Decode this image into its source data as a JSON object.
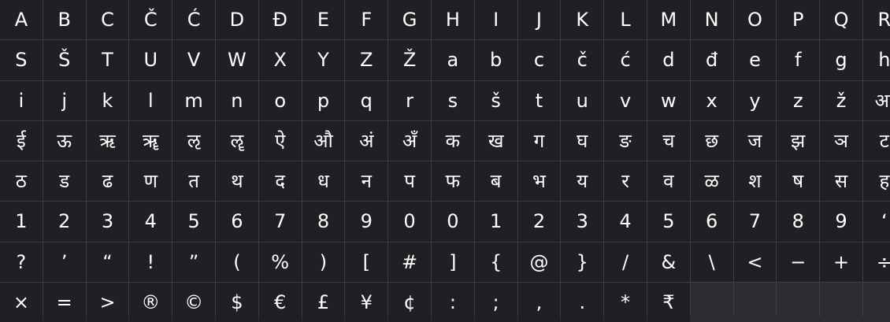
{
  "glyph_grid": {
    "glyphs": [
      "A",
      "B",
      "C",
      "Č",
      "Ć",
      "D",
      "Đ",
      "E",
      "F",
      "G",
      "H",
      "I",
      "J",
      "K",
      "L",
      "M",
      "N",
      "O",
      "P",
      "Q",
      "R",
      "S",
      "Š",
      "T",
      "U",
      "V",
      "W",
      "X",
      "Y",
      "Z",
      "Ž",
      "a",
      "b",
      "c",
      "č",
      "ć",
      "d",
      "đ",
      "e",
      "f",
      "g",
      "h",
      "i",
      "j",
      "k",
      "l",
      "m",
      "n",
      "o",
      "p",
      "q",
      "r",
      "s",
      "š",
      "t",
      "u",
      "v",
      "w",
      "x",
      "y",
      "z",
      "ž",
      "आ",
      "ई",
      "ऊ",
      "ऋ",
      "ॠ",
      "ऌ",
      "ॡ",
      "ऐ",
      "औ",
      "अं",
      "अँ",
      "क",
      "ख",
      "ग",
      "घ",
      "ङ",
      "च",
      "छ",
      "ज",
      "झ",
      "ञ",
      "ट",
      "ठ",
      "ड",
      "ढ",
      "ण",
      "त",
      "थ",
      "द",
      "ध",
      "न",
      "प",
      "फ",
      "ब",
      "भ",
      "य",
      "र",
      "व",
      "ळ",
      "श",
      "ष",
      "स",
      "ह",
      "1",
      "2",
      "3",
      "4",
      "5",
      "6",
      "7",
      "8",
      "9",
      "0",
      "0",
      "1",
      "2",
      "3",
      "4",
      "5",
      "6",
      "7",
      "8",
      "9",
      "‘",
      "?",
      "’",
      "“",
      "!",
      "”",
      "(",
      "%",
      ")",
      "[",
      "#",
      "]",
      "{",
      "@",
      "}",
      "/",
      "&",
      "\\",
      "<",
      "−",
      "+",
      "÷",
      "×",
      "=",
      ">",
      "®",
      "©",
      "$",
      "€",
      "£",
      "¥",
      "¢",
      ":",
      ";",
      ",",
      ".",
      "*",
      "₹"
    ]
  }
}
